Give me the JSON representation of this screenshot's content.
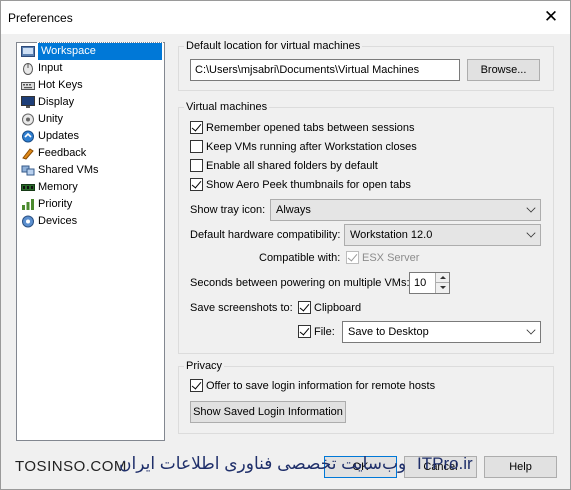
{
  "window": {
    "title": "Preferences",
    "close_glyph": "✕"
  },
  "nav": {
    "items": [
      {
        "label": "Workspace",
        "icon": "workspace-icon",
        "selected": true
      },
      {
        "label": "Input",
        "icon": "mouse-icon"
      },
      {
        "label": "Hot Keys",
        "icon": "keyboard-icon"
      },
      {
        "label": "Display",
        "icon": "monitor-icon"
      },
      {
        "label": "Unity",
        "icon": "unity-icon"
      },
      {
        "label": "Updates",
        "icon": "updates-icon"
      },
      {
        "label": "Feedback",
        "icon": "feedback-icon"
      },
      {
        "label": "Shared VMs",
        "icon": "shared-vms-icon"
      },
      {
        "label": "Memory",
        "icon": "memory-icon"
      },
      {
        "label": "Priority",
        "icon": "priority-icon"
      },
      {
        "label": "Devices",
        "icon": "devices-icon"
      }
    ]
  },
  "location": {
    "legend": "Default location for virtual machines",
    "path": "C:\\Users\\mjsabri\\Documents\\Virtual Machines",
    "browse_label": "Browse..."
  },
  "vm": {
    "legend": "Virtual machines",
    "options": [
      {
        "label": "Remember opened tabs between sessions",
        "checked": true
      },
      {
        "label": "Keep VMs running after Workstation closes",
        "checked": false
      },
      {
        "label": "Enable all shared folders by default",
        "checked": false
      },
      {
        "label": "Show Aero Peek thumbnails for open tabs",
        "checked": true
      }
    ],
    "tray_label": "Show tray icon:",
    "tray_value": "Always",
    "hw_label": "Default hardware compatibility:",
    "hw_value": "Workstation 12.0",
    "compat_label": "Compatible with:",
    "compat_value": "ESX Server",
    "seconds_label": "Seconds between powering on multiple VMs:",
    "seconds_value": "10",
    "screens_label": "Save screenshots to:",
    "clipboard_label": "Clipboard",
    "file_label": "File:",
    "file_value": "Save to Desktop"
  },
  "privacy": {
    "legend": "Privacy",
    "offer_label": "Offer to save login information for remote hosts",
    "show_saved_label": "Show Saved Login Information"
  },
  "footer": {
    "ok_label": "OK",
    "cancel_label": "Cancel",
    "help_label": "Help"
  },
  "watermark": {
    "left": "TOSINSO.COM",
    "middle": "وب‌سایت تخصصی فناوری اطلاعات ایران",
    "right": "ITPro.ir"
  }
}
